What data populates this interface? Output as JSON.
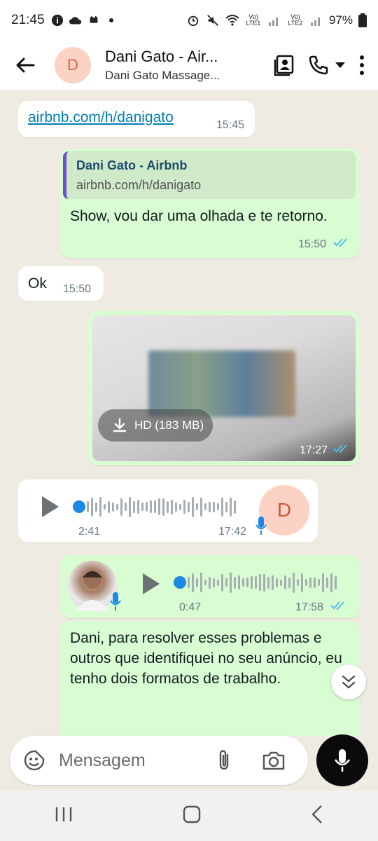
{
  "status_bar": {
    "time": "21:45",
    "battery": "97%",
    "sim1_label": "Vo) LTE1",
    "sim2_label": "Vo) LTE2"
  },
  "header": {
    "avatar_initial": "D",
    "contact_name": "Dani Gato - Air...",
    "contact_subtitle": "Dani Gato Massage..."
  },
  "messages": {
    "m1": {
      "link_text": "airbnb.com/h/danigato",
      "time": "15:45"
    },
    "m2": {
      "quote_title": "Dani Gato - Airbnb",
      "quote_subtitle": "airbnb.com/h/danigato",
      "text": "Show, vou dar uma olhada e te retorno.",
      "time": "15:50"
    },
    "m3": {
      "text": "Ok",
      "time": "15:50"
    },
    "m4": {
      "download_label": "HD (183 MB)",
      "time": "17:27"
    },
    "m5": {
      "duration": "2:41",
      "time": "17:42",
      "avatar_initial": "D"
    },
    "m6": {
      "duration": "0:47",
      "time": "17:58"
    },
    "m7": {
      "text": "Dani, para resolver esses problemas e outros que identifiquei no seu anúncio, eu tenho dois formatos de trabalho."
    }
  },
  "composer": {
    "placeholder": "Mensagem"
  },
  "colors": {
    "incoming_bubble": "#ffffff",
    "outgoing_bubble": "#d9fdd3",
    "read_ticks": "#53bdeb",
    "avatar_bg": "#fbd2c4",
    "mic_button": "#0b0b0b"
  }
}
